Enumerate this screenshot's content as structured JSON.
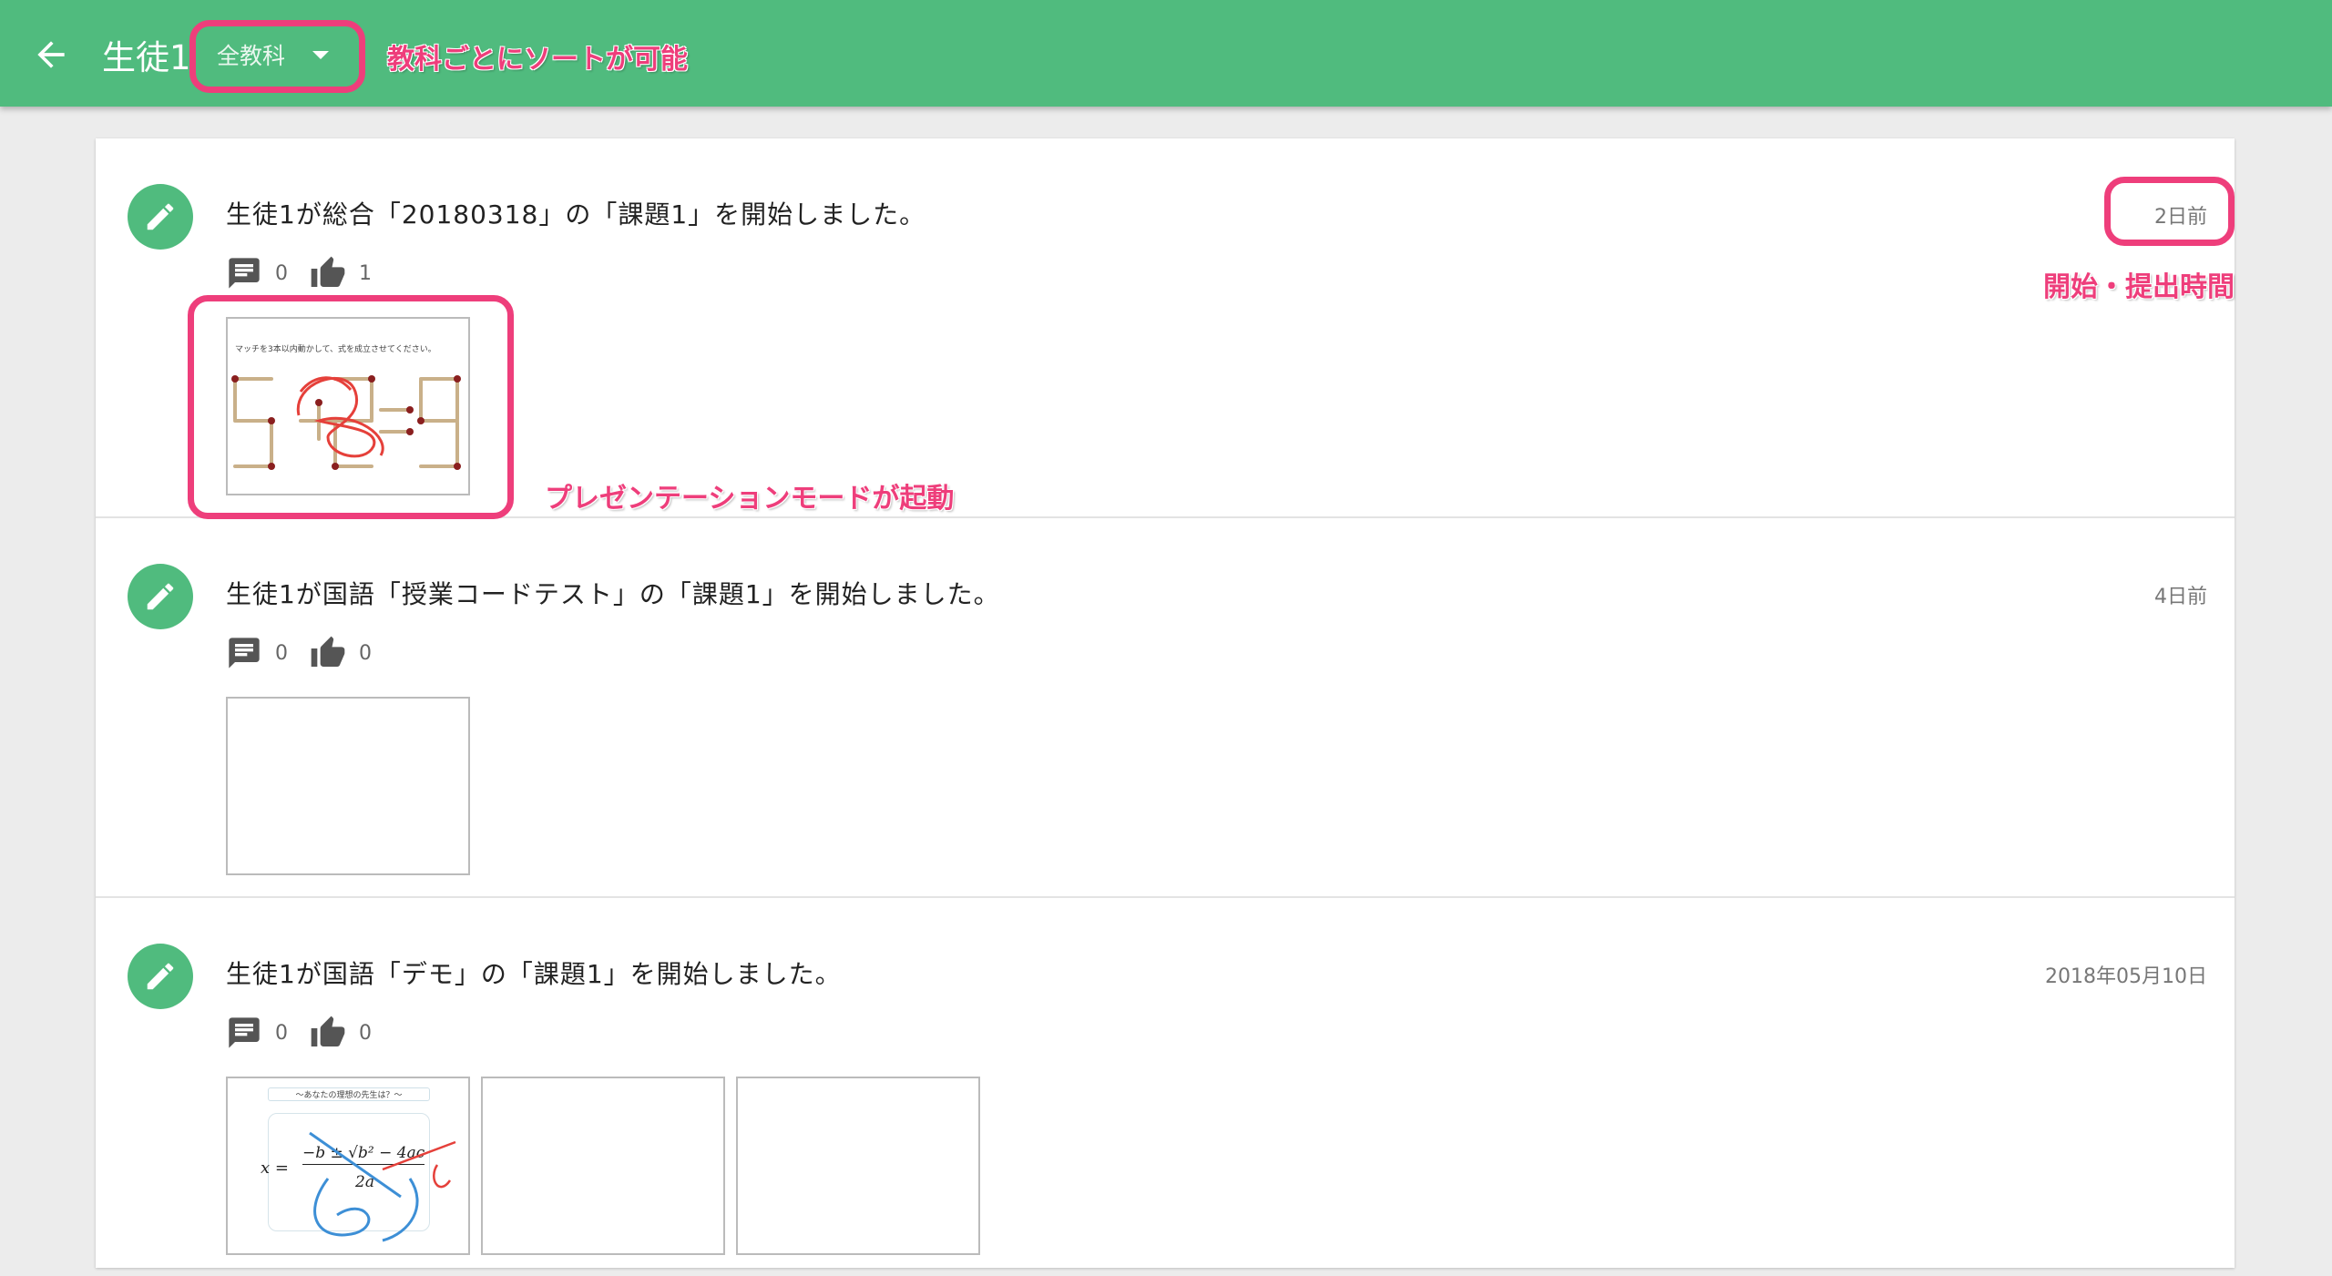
{
  "header": {
    "title": "生徒1",
    "subject_filter": "全教科",
    "back_icon": "arrow-left-icon",
    "bg_color": "#50bb7e"
  },
  "annotations": {
    "sort_note": "教科ごとにソートが可能",
    "time_note": "開始・提出時間",
    "presentation_note": "プレゼンテーションモードが起動",
    "color": "#ee3e7b"
  },
  "feed": [
    {
      "message": "生徒1が総合「20180318」の「課題1」を開始しました。",
      "time": "2日前",
      "comments": "0",
      "likes": "1",
      "thumbnails": [
        {
          "kind": "matchstick",
          "caption": "マッチを3本以内動かして、式を成立させてください。"
        }
      ]
    },
    {
      "message": "生徒1が国語「授業コードテスト」の「課題1」を開始しました。",
      "time": "4日前",
      "comments": "0",
      "likes": "0",
      "thumbnails": [
        {
          "kind": "blank"
        }
      ]
    },
    {
      "message": "生徒1が国語「デモ」の「課題1」を開始しました。",
      "time": "2018年05月10日",
      "comments": "0",
      "likes": "0",
      "thumbnails": [
        {
          "kind": "formula",
          "caption": "〜あなたの理想の先生は？〜",
          "formula": "x =",
          "numerator": "−b ± √b² − 4ac",
          "denominator": "2a"
        },
        {
          "kind": "blank"
        },
        {
          "kind": "blank"
        }
      ]
    }
  ]
}
